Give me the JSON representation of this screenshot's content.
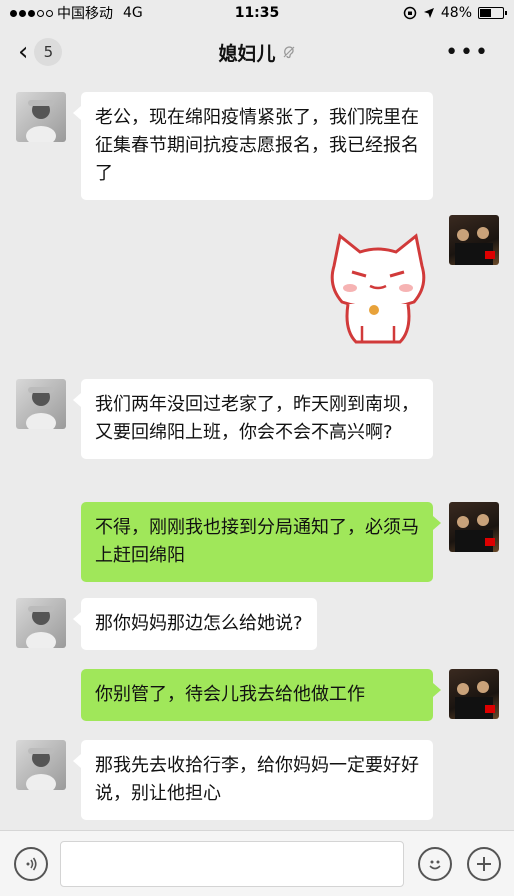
{
  "status_bar": {
    "carrier": "中国移动",
    "network": "4G",
    "time": "11:35",
    "battery": "48%",
    "battery_level": 0.48
  },
  "nav": {
    "unread_count": "5",
    "title": "媳妇儿"
  },
  "messages": [
    {
      "side": "left",
      "text": "老公，现在绵阳疫情紧张了，我们院里在征集春节期间抗疫志愿报名，我已经报名了"
    },
    {
      "side": "right",
      "type": "sticker",
      "sticker": "cat-sticker"
    },
    {
      "side": "left",
      "text": "我们两年没回过老家了，昨天刚到南坝，又要回绵阳上班，你会不会不高兴啊?"
    },
    {
      "side": "right",
      "text": "不得，刚刚我也接到分局通知了，必须马上赶回绵阳"
    },
    {
      "side": "left",
      "text": "那你妈妈那边怎么给她说?"
    },
    {
      "side": "right",
      "text": "你别管了，待会儿我去给他做工作"
    },
    {
      "side": "left",
      "text": "那我先去收拾行李，给你妈妈一定要好好说，别让他担心"
    }
  ],
  "input": {
    "placeholder": ""
  },
  "colors": {
    "background": "#ebebeb",
    "self_bubble": "#a0e75a",
    "other_bubble": "#ffffff"
  }
}
